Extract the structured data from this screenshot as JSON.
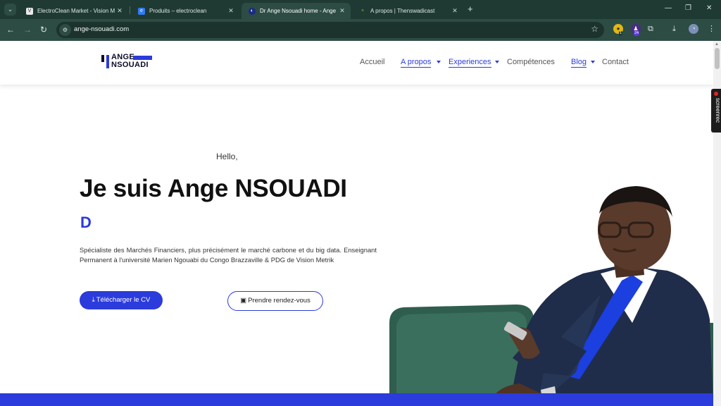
{
  "browser": {
    "tabs": [
      {
        "title": "ElectroClean Market - Vision M",
        "favicon_color": "#e8e8e8",
        "active": false
      },
      {
        "title": "Produits – electroclean",
        "favicon_color": "#2f7bf6",
        "active": false
      },
      {
        "title": "Dr Ange Nsouadi home - Ange",
        "favicon_color": "#2b3bdc",
        "active": true
      },
      {
        "title": "A propos | Thenswadicast",
        "favicon_color": "#3b7a2a",
        "active": false
      }
    ],
    "url": "ange-nsouadi.com",
    "extension_badges": {
      "first": "1",
      "second": "24"
    }
  },
  "site": {
    "logo": {
      "line1": "ANGE",
      "line2": "NSOUADI"
    },
    "nav": [
      {
        "label": "Accueil",
        "has_dropdown": false
      },
      {
        "label": "A propos",
        "has_dropdown": true
      },
      {
        "label": "Experiences",
        "has_dropdown": true
      },
      {
        "label": "Compétences",
        "has_dropdown": false
      },
      {
        "label": "Blog",
        "has_dropdown": true
      },
      {
        "label": "Contact",
        "has_dropdown": false
      }
    ],
    "hero": {
      "greeting": "Hello,",
      "headline": "Je suis Ange NSOUADI",
      "typed_text": "D",
      "description": "Spécialiste des Marchés Financiers, plus précisément le marché carbone et du big data. Enseignant Permanent à l'université Marien Ngouabi du Congo Brazzaville & PDG de Vision Metrik",
      "cta_primary": "Télécharger le CV",
      "cta_secondary": "Prendre rendez-vous"
    },
    "colors": {
      "accent": "#2b3bdc",
      "text": "#111111"
    }
  },
  "overlay": {
    "screenrec_label": "screenrec"
  }
}
